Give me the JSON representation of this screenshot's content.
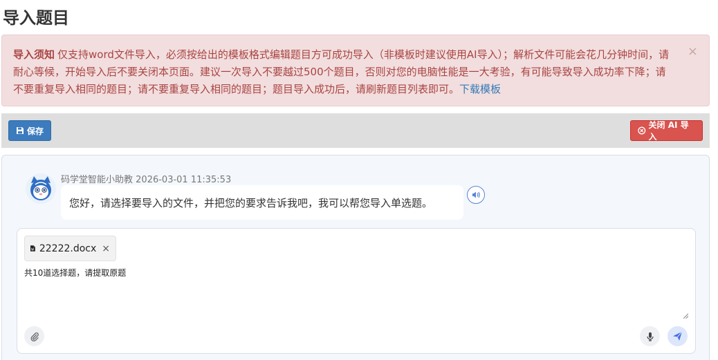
{
  "page": {
    "title": "导入题目"
  },
  "alert": {
    "heading": "导入须知",
    "body": "仅支持word文件导入，必须按给出的模板格式编辑题目方可成功导入（非模板时建议使用AI导入）；解析文件可能会花几分钟时间，请耐心等候，开始导入后不要关闭本页面。建议一次导入不要越过500个题目，否则对您的电脑性能是一大考验，有可能导致导入成功率下降；请不要重复导入相同的题目；请不要重复导入相同的题目；题目导入成功后，请刷新题目列表即可。",
    "link_label": "下载模板",
    "close_glyph": "×"
  },
  "toolbar": {
    "save_label": "保存",
    "close_ai_label": "关闭 AI 导入"
  },
  "chat": {
    "message": {
      "sender": "码学堂智能小助教",
      "timestamp": "2026-03-01 11:35:53",
      "text": "您好，请选择要导入的文件，并把您的要求告诉我吧，我可以帮您导入单选题。"
    },
    "composer": {
      "attachment": {
        "filename": "22222.docx",
        "remove_glyph": "×"
      },
      "input_value": "共10道选择题，请提取原题"
    }
  },
  "colors": {
    "accent": "#3c7bbd",
    "danger": "#d9534f",
    "alert_bg": "#f2dede",
    "alert_text": "#a94442",
    "link": "#337ab7",
    "send_icon": "#3f6ee0"
  },
  "icons": [
    "save-icon",
    "close-circle-icon",
    "assistant-avatar",
    "speaker-icon",
    "word-file-icon",
    "paperclip-icon",
    "microphone-icon",
    "send-icon"
  ]
}
